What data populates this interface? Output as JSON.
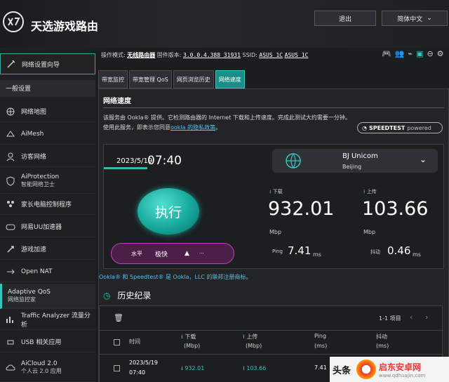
{
  "app": {
    "brand": "天选游戏路由"
  },
  "header": {
    "logout_label": "退出",
    "language_label": "简体中文"
  },
  "status": {
    "mode_label": "操作模式:",
    "mode_value": "无线路由器",
    "firmware_label": "固件版本:",
    "firmware_value": "3.0.0.4.388_31931",
    "ssid_label": "SSID:",
    "ssid_1": "ASUS_1C",
    "ssid_2": "ASUS_1C"
  },
  "sidebar": {
    "wizard": "网络设置向导",
    "general": "一般设置",
    "items": [
      {
        "label": "网络地图",
        "sub": ""
      },
      {
        "label": "AiMesh",
        "sub": ""
      },
      {
        "label": "访客网络",
        "sub": ""
      },
      {
        "label": "AiProtection",
        "sub": "智能网络卫士"
      },
      {
        "label": "家长电脑控制程序",
        "sub": ""
      },
      {
        "label": "网易UU加速器",
        "sub": ""
      },
      {
        "label": "游戏加速",
        "sub": ""
      },
      {
        "label": "Open NAT",
        "sub": ""
      },
      {
        "label": "Adaptive QoS",
        "sub": "网络监控家"
      },
      {
        "label": "Traffic Analyzer 流量分析",
        "sub": ""
      },
      {
        "label": "USB 相关应用",
        "sub": ""
      },
      {
        "label": "AiCloud 2.0",
        "sub": "个人云 2.0 应用"
      }
    ]
  },
  "tabs": [
    "带宽监控",
    "带宽管理 QoS",
    "网页浏览历史",
    "网络速度"
  ],
  "speed": {
    "title": "网络速度",
    "desc_1": "该服务由 Ookla® 提供。它检测路由器的 Internet 下载和上传速度。完成此测试大约需要一分钟。使用此服务，即表示您同意",
    "desc_link": "ookla 的隐私政策",
    "desc_end": "。",
    "badge": "SPEEDTEST",
    "badge_suffix": "powered",
    "date": "2023/5/19",
    "time": "07:40",
    "isp_name": "BJ Unicom",
    "isp_city": "Beijing",
    "run_label": "执行",
    "mode_level": "水平",
    "mode_value": "极快",
    "more": "···",
    "download_label": "下载",
    "download_value": "932.01",
    "upload_label": "上传",
    "upload_value": "103.66",
    "unit": "Mbp",
    "ping_label": "Ping",
    "ping_value": "7.41",
    "ping_unit": "ms",
    "jitter_label": "抖动",
    "jitter_value": "0.46",
    "jitter_unit": "ms",
    "footnote": "Ookla® 和 Speedtest® 是 Ookla，LLC 的联邦注册商标。"
  },
  "history": {
    "title": "历史纪录",
    "pager": "1-1 项目",
    "columns": {
      "time": "时间",
      "download": "下载",
      "download_unit": "(Mbp)",
      "upload": "上传",
      "upload_unit": "(Mbp)",
      "ping": "Ping",
      "ping_unit": "(ms)",
      "jitter": "抖动",
      "jitter_unit": "(ms)"
    },
    "rows": [
      {
        "date": "2023/5/19",
        "time": "07:40",
        "download": "932.01",
        "upload": "103.66",
        "ping": "7.41"
      }
    ]
  },
  "watermark": {
    "source": "头条",
    "brand": "启东安卓网",
    "url": "www.qdhuajin.com"
  },
  "colors": {
    "accent": "#1a8f87",
    "link": "#4fc3f7",
    "mode_border": "#c73cc2"
  }
}
